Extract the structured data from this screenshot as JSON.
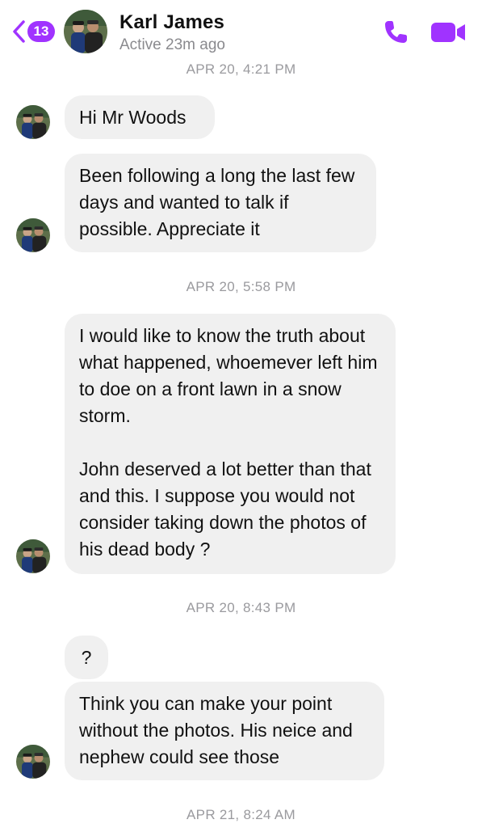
{
  "header": {
    "back_badge": "13",
    "contact_name": "Karl James",
    "status": "Active 23m ago",
    "call_icon": "phone-icon",
    "video_icon": "video-camera-icon"
  },
  "colors": {
    "accent": "#a033ff",
    "bubble": "#f0f0f0",
    "timestamp": "#9a9a9e"
  },
  "messages": {
    "ts1": "APR 20, 4:21 PM",
    "m1": "Hi Mr Woods",
    "m2": "Been following a long the last few days and wanted to talk if possible. Appreciate it",
    "ts2": "APR 20, 5:58 PM",
    "m3": "I would like to know the truth about what happened, whoemever left him to doe on a front  lawn in a snow storm.\n\nJohn deserved a lot better than that and this. I suppose you would not consider taking down the photos of his dead body ?",
    "ts3": "APR 20, 8:43 PM",
    "m4": "?",
    "m5": "Think you can make your point without the photos. His neice and nephew could see those",
    "ts4": "APR 21, 8:24 AM"
  }
}
